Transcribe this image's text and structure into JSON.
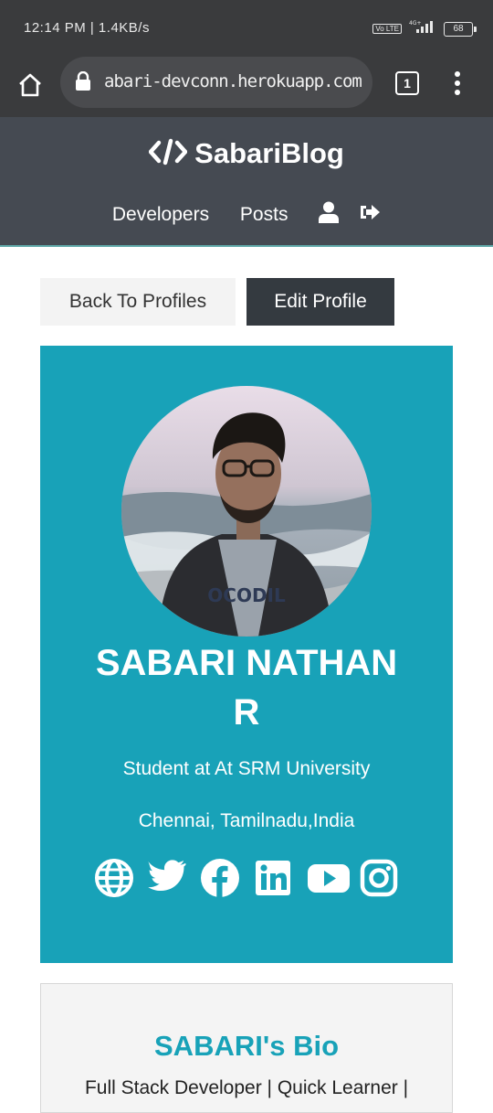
{
  "status_bar": {
    "time": "12:14 PM | 1.4KB/s",
    "network": "4G+",
    "volte": "Vo LTE",
    "battery": "68"
  },
  "browser": {
    "url": "abari-devconn.herokuapp.com",
    "tab_count": "1"
  },
  "navbar": {
    "brand": "SabariBlog",
    "links": [
      "Developers",
      "Posts"
    ]
  },
  "actions": {
    "back_label": "Back To Profiles",
    "edit_label": "Edit Profile"
  },
  "profile": {
    "name_line1": "SABARI NATHAN",
    "name_line2": "R",
    "status": "Student at At SRM University",
    "location": "Chennai, Tamilnadu,India",
    "socials": [
      "globe-icon",
      "twitter-icon",
      "facebook-icon",
      "linkedin-icon",
      "youtube-icon",
      "instagram-icon"
    ]
  },
  "bio": {
    "title": "SABARI's Bio",
    "text": "Full Stack Developer | Quick Learner |"
  },
  "colors": {
    "accent": "#18a2b8",
    "navbar": "#454a52",
    "dark_button": "#343a40",
    "chrome": "#3a3b3d"
  }
}
